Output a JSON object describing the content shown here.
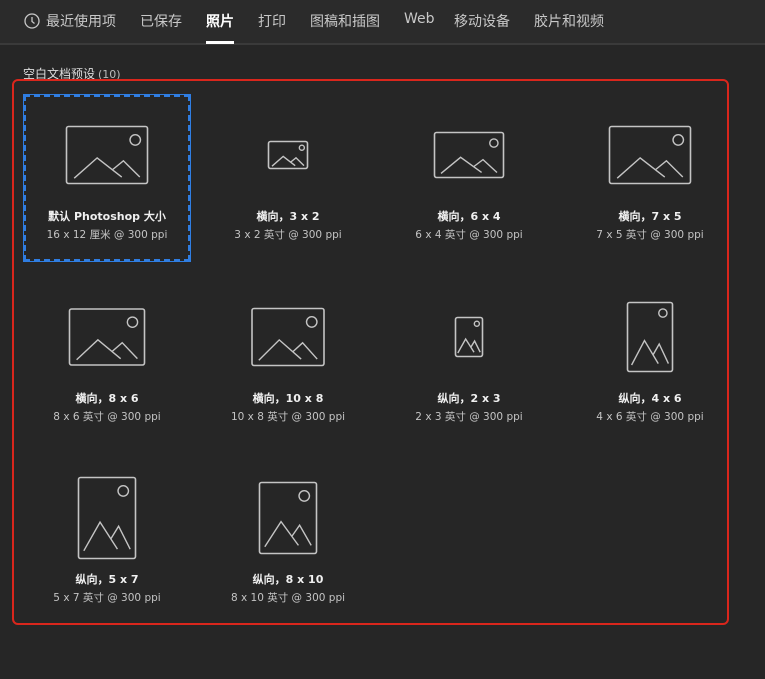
{
  "tabs": [
    {
      "label": "最近使用项",
      "icon": "clock-icon"
    },
    {
      "label": "已保存"
    },
    {
      "label": "照片",
      "active": true
    },
    {
      "label": "打印"
    },
    {
      "label": "图稿和插图"
    },
    {
      "label": "Web"
    },
    {
      "label": "移动设备"
    },
    {
      "label": "胶片和视频"
    }
  ],
  "section": {
    "title": "空白文档预设",
    "count": "(10)"
  },
  "presets": [
    {
      "title": "默认 Photoshop 大小",
      "subtitle": "16 x 12 厘米 @ 300 ppi",
      "selected": true
    },
    {
      "title": "横向，3 x 2",
      "subtitle": "3 x 2 英寸 @ 300 ppi"
    },
    {
      "title": "横向，6 x 4",
      "subtitle": "6 x 4 英寸 @ 300 ppi"
    },
    {
      "title": "横向，7 x 5",
      "subtitle": "7 x 5 英寸 @ 300 ppi"
    },
    {
      "title": "横向，8 x 6",
      "subtitle": "8 x 6 英寸 @ 300 ppi"
    },
    {
      "title": "横向，10 x 8",
      "subtitle": "10 x 8 英寸 @ 300 ppi"
    },
    {
      "title": "纵向，2 x 3",
      "subtitle": "2 x 3 英寸 @ 300 ppi"
    },
    {
      "title": "纵向，4 x 6",
      "subtitle": "4 x 6 英寸 @ 300 ppi"
    },
    {
      "title": "纵向，5 x 7",
      "subtitle": "5 x 7 英寸 @ 300 ppi"
    },
    {
      "title": "纵向，8 x 10",
      "subtitle": "8 x 10 英寸 @ 300 ppi"
    }
  ],
  "colors": {
    "selection": "#2f7de1",
    "highlight": "#d9261c"
  }
}
